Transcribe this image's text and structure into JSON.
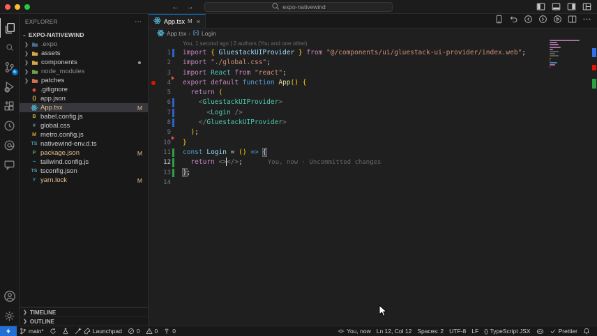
{
  "title_bar": {
    "search_value": "expo-nativewind",
    "back_arrow": "←",
    "forward_arrow": "→"
  },
  "activity_bar": {
    "items": [
      {
        "name": "explorer-icon",
        "icon": "files",
        "active": true
      },
      {
        "name": "search-icon",
        "icon": "search"
      },
      {
        "name": "source-control-icon",
        "icon": "scm",
        "badge": "6"
      },
      {
        "name": "run-debug-icon",
        "icon": "debug"
      },
      {
        "name": "extensions-icon",
        "icon": "extensions"
      },
      {
        "name": "live-preview-icon",
        "icon": "circleplay"
      },
      {
        "name": "copilot-chat-icon",
        "icon": "circleat"
      },
      {
        "name": "remote-explorer-icon",
        "icon": "chat"
      }
    ],
    "bottom": [
      {
        "name": "accounts-icon",
        "icon": "person"
      },
      {
        "name": "settings-gear-icon",
        "icon": "gear"
      }
    ]
  },
  "sidebar": {
    "title": "EXPLORER",
    "more_actions": "⋯",
    "project": "EXPO-NATIVEWIND",
    "files": [
      {
        "name": ".expo",
        "kind": "folder",
        "color": "#4f6b8f",
        "dim": true
      },
      {
        "name": "assets",
        "kind": "folder",
        "color": "#d8a549"
      },
      {
        "name": "components",
        "kind": "folder",
        "color": "#d8a549",
        "dot": true
      },
      {
        "name": "node_modules",
        "kind": "folder",
        "color": "#6f9e4e",
        "dim": true
      },
      {
        "name": "patches",
        "kind": "folder",
        "color": "#d8734f"
      },
      {
        "name": ".gitignore",
        "kind": "file",
        "glyph": "◆",
        "color": "#e84e31"
      },
      {
        "name": "app.json",
        "kind": "file",
        "glyph": "{}",
        "color": "#e8c341"
      },
      {
        "name": "App.tsx",
        "kind": "file",
        "glyph": "react",
        "color": "#53c1de",
        "selected": true,
        "modified": true,
        "badge": "M"
      },
      {
        "name": "babel.config.js",
        "kind": "file",
        "glyph": "B",
        "color": "#c9b33f"
      },
      {
        "name": "global.css",
        "kind": "file",
        "glyph": "#",
        "color": "#519aba"
      },
      {
        "name": "metro.config.js",
        "kind": "file",
        "glyph": "M",
        "color": "#e8a33d"
      },
      {
        "name": "nativewind-env.d.ts",
        "kind": "file",
        "glyph": "TS",
        "color": "#519aba"
      },
      {
        "name": "package.json",
        "kind": "file",
        "glyph": "P",
        "color": "#689f63",
        "modified": true,
        "badge": "M"
      },
      {
        "name": "tailwind.config.js",
        "kind": "file",
        "glyph": "~",
        "color": "#38bdf8"
      },
      {
        "name": "tsconfig.json",
        "kind": "file",
        "glyph": "TS",
        "color": "#519aba"
      },
      {
        "name": "yarn.lock",
        "kind": "file",
        "glyph": "Y",
        "color": "#368fb9",
        "modified": true,
        "badge": "M"
      }
    ],
    "bottom_sections": [
      {
        "label": "TIMELINE"
      },
      {
        "label": "OUTLINE"
      }
    ]
  },
  "editor": {
    "tab": {
      "label": "App.tsx",
      "modified_indicator": "M",
      "close": "×"
    },
    "breadcrumb": {
      "file": "App.tsx",
      "separator": "›",
      "symbol": "Login"
    },
    "codelens": "You, 1 second ago | 2 authors (You and one other)",
    "ghost_text": "You, now · Uncommitted changes",
    "code_lines": [
      {
        "num": "1",
        "git": "mod",
        "tokens": [
          [
            "import",
            "kw"
          ],
          [
            " ",
            ""
          ],
          [
            "{",
            "gold"
          ],
          [
            " GluestackUIProvider ",
            "id"
          ],
          [
            "}",
            "gold"
          ],
          [
            " ",
            ""
          ],
          [
            "from",
            "kw"
          ],
          [
            " ",
            ""
          ],
          [
            "\"@/components/ui/gluestack-ui-provider/index.web\"",
            "str"
          ],
          [
            ";",
            "fg"
          ]
        ]
      },
      {
        "num": "2",
        "tokens": [
          [
            "import",
            "kw"
          ],
          [
            " ",
            ""
          ],
          [
            "\"./global.css\"",
            "str"
          ],
          [
            ";",
            "fg"
          ]
        ]
      },
      {
        "num": "3",
        "tokens": [
          [
            "import",
            "kw"
          ],
          [
            " ",
            ""
          ],
          [
            "React",
            "type"
          ],
          [
            " ",
            ""
          ],
          [
            "from",
            "kw"
          ],
          [
            " ",
            ""
          ],
          [
            "\"react\"",
            "str"
          ],
          [
            ";",
            "fg"
          ]
        ]
      },
      {
        "num": "4",
        "git": "deltop",
        "breakpoint": true,
        "tokens": [
          [
            "export",
            "kw"
          ],
          [
            " ",
            ""
          ],
          [
            "default",
            "kw"
          ],
          [
            " ",
            ""
          ],
          [
            "function",
            "kw2"
          ],
          [
            " ",
            ""
          ],
          [
            "App",
            "fn"
          ],
          [
            "()",
            "gold"
          ],
          [
            " ",
            ""
          ],
          [
            "{",
            "gold"
          ]
        ]
      },
      {
        "num": "5",
        "tokens": [
          [
            "  return",
            "kw"
          ],
          [
            " ",
            ""
          ],
          [
            "(",
            "gold"
          ]
        ]
      },
      {
        "num": "6",
        "git": "mod",
        "tokens": [
          [
            "    ",
            ""
          ],
          [
            "<",
            "tagp"
          ],
          [
            "GluestackUIProvider",
            "type"
          ],
          [
            ">",
            "tagp"
          ]
        ]
      },
      {
        "num": "7",
        "git": "mod",
        "tokens": [
          [
            "      ",
            ""
          ],
          [
            "<",
            "tagp"
          ],
          [
            "Login",
            "type"
          ],
          [
            " ",
            ""
          ],
          [
            "/>",
            "tagp"
          ]
        ]
      },
      {
        "num": "8",
        "git": "mod",
        "tokens": [
          [
            "    ",
            ""
          ],
          [
            "</",
            "tagp"
          ],
          [
            "GluestackUIProvider",
            "type"
          ],
          [
            ">",
            "tagp"
          ]
        ]
      },
      {
        "num": "9",
        "git": "delbot",
        "tokens": [
          [
            "  ",
            ""
          ],
          [
            ")",
            "gold"
          ],
          [
            ";",
            "fg"
          ]
        ]
      },
      {
        "num": "10",
        "tokens": [
          [
            "}",
            "gold"
          ]
        ]
      },
      {
        "num": "11",
        "git": "add",
        "tokens": [
          [
            "const",
            "kw2"
          ],
          [
            " ",
            ""
          ],
          [
            "Login",
            "id"
          ],
          [
            " =",
            "fg"
          ],
          [
            " ",
            ""
          ],
          [
            "()",
            "gold"
          ],
          [
            " ",
            ""
          ],
          [
            "=>",
            "kw2"
          ],
          [
            " ",
            ""
          ],
          [
            "{",
            "fg box"
          ]
        ]
      },
      {
        "num": "12",
        "git": "add",
        "active": true,
        "ghost": true,
        "tokens": [
          [
            "  return",
            "kw"
          ],
          [
            " ",
            ""
          ],
          [
            "<>",
            "tagp"
          ],
          [
            "|",
            "cursor"
          ],
          [
            "</>",
            "tagp"
          ],
          [
            ";",
            "fg"
          ]
        ]
      },
      {
        "num": "13",
        "git": "add",
        "tokens": [
          [
            "}",
            "fg box"
          ],
          [
            ";",
            "fg"
          ]
        ]
      },
      {
        "num": "14",
        "tokens": []
      }
    ]
  },
  "status_bar": {
    "left": [
      {
        "name": "remote-indicator",
        "icons": [
          "lightning"
        ],
        "label": "",
        "chip": true
      },
      {
        "name": "git-branch",
        "icons": [
          "branch"
        ],
        "label": "main*"
      },
      {
        "name": "sync-changes",
        "icons": [
          "sync"
        ],
        "label": ""
      },
      {
        "name": "expo-tools",
        "icons": [
          "beaker"
        ],
        "label": ""
      },
      {
        "name": "launchpad",
        "icons": [
          "wand",
          "rocket"
        ],
        "label": "Launchpad"
      },
      {
        "name": "problems-errors",
        "icons": [
          "errcircle"
        ],
        "label": "0"
      },
      {
        "name": "problems-warnings",
        "icons": [
          "warntri"
        ],
        "label": "0"
      },
      {
        "name": "ports",
        "icons": [
          "antenna"
        ],
        "label": "0"
      }
    ],
    "right": [
      {
        "name": "gitlens-blame",
        "icons": [
          "commit"
        ],
        "label": "You, now"
      },
      {
        "name": "cursor-position",
        "icons": [],
        "label": "Ln 12, Col 12"
      },
      {
        "name": "indentation",
        "icons": [],
        "label": "Spaces: 2"
      },
      {
        "name": "encoding",
        "icons": [],
        "label": "UTF-8"
      },
      {
        "name": "eol",
        "icons": [],
        "label": "LF"
      },
      {
        "name": "language-mode",
        "icons": [
          "braces"
        ],
        "label": "TypeScript JSX"
      },
      {
        "name": "copilot-status",
        "icons": [
          "copilot"
        ],
        "label": ""
      },
      {
        "name": "formatter-prettier",
        "icons": [
          "check"
        ],
        "label": "Prettier"
      },
      {
        "name": "notifications-bell",
        "icons": [
          "bell"
        ],
        "label": ""
      }
    ]
  },
  "colors": {
    "accent_blue": "#0078d4",
    "git_modified": "#e2c08d",
    "gutter_modified": "#2f6feb",
    "gutter_added": "#2ea043",
    "gutter_deleted": "#f14c4c",
    "breakpoint_red": "#e51400"
  }
}
